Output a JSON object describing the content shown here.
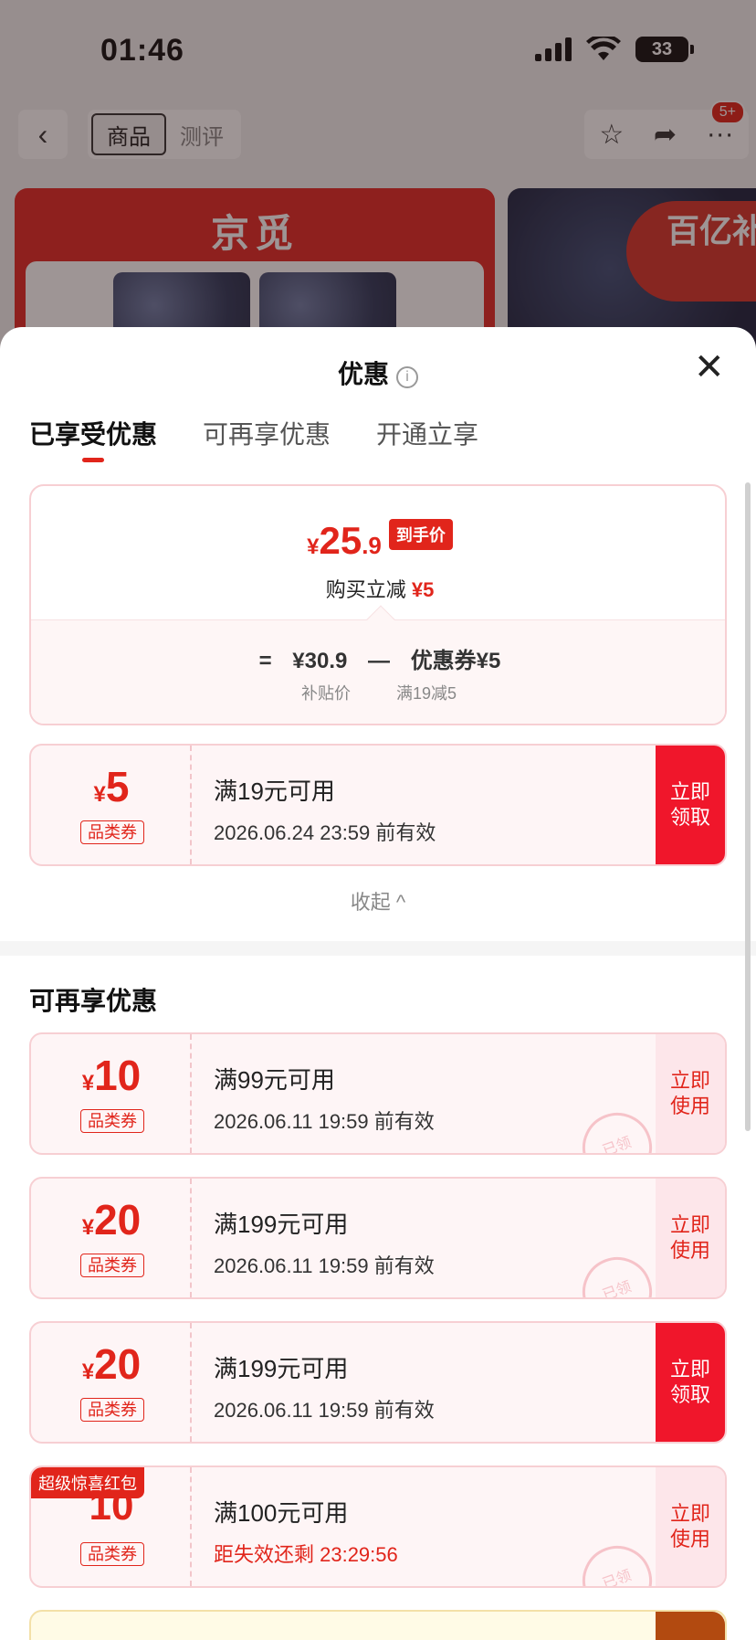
{
  "status": {
    "time": "01:46",
    "battery": "33"
  },
  "nav": {
    "back_icon": "chevron-left-icon",
    "tabs": [
      "商品",
      "测评"
    ],
    "badge": "5+"
  },
  "banner": {
    "logo_text": "京觅",
    "subsidy_text": "百亿补贴"
  },
  "sheet": {
    "title": "优惠",
    "tabs": [
      {
        "label": "已享受优惠",
        "active": true
      },
      {
        "label": "可再享优惠",
        "active": false
      },
      {
        "label": "开通立享",
        "active": false
      }
    ],
    "price_card": {
      "yen": "¥",
      "price_int": "25",
      "price_dec": ".9",
      "price_tag": "到手价",
      "reduce_label": "购买立减",
      "reduce_amount": "¥5",
      "calc_equals": "=",
      "calc_base": "¥30.9",
      "calc_minus": "—",
      "calc_coupon": "优惠券¥5",
      "calc_base_label": "补贴价",
      "calc_coupon_label": "满19减5"
    },
    "enjoyed_coupon": {
      "yen": "¥",
      "amount": "5",
      "type": "品类券",
      "condition": "满19元可用",
      "expiry": "2026.06.24 23:59 前有效",
      "button": "立即领取"
    },
    "collapse_label": "收起 ^",
    "section_title": "可再享优惠",
    "more_coupons": [
      {
        "yen": "¥",
        "amount": "10",
        "type": "品类券",
        "condition": "满99元可用",
        "expiry": "2026.06.11 19:59 前有效",
        "button": "立即使用",
        "stamp": "已领"
      },
      {
        "yen": "¥",
        "amount": "20",
        "type": "品类券",
        "condition": "满199元可用",
        "expiry": "2026.06.11 19:59 前有效",
        "button": "立即使用",
        "stamp": "已领"
      },
      {
        "yen": "¥",
        "amount": "20",
        "type": "品类券",
        "condition": "满199元可用",
        "expiry": "2026.06.11 19:59 前有效",
        "button": "立即领取"
      },
      {
        "tag": "超级惊喜红包",
        "amount": "10",
        "type": "品类券",
        "condition": "满100元可用",
        "expiry": "距失效还剩 23:29:56",
        "button": "立即使用",
        "stamp": "已领"
      }
    ]
  },
  "colors": {
    "accent": "#e1251b",
    "coupon_bg": "#fef5f6",
    "coupon_border": "#f7cfd3"
  }
}
